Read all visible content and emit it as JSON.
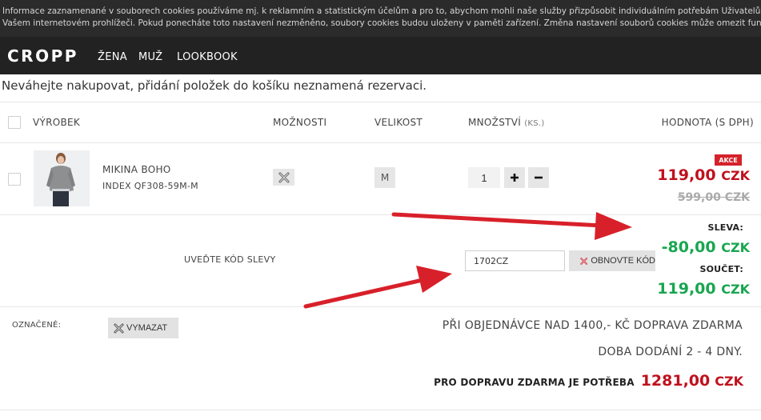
{
  "cookie_bar": {
    "line1": "Informace zaznamenané v souborech cookies používáme mj. k reklamním a statistickým účelům a pro to, abychom mohli naše služby přizpůsobit individuálním potřebám Uživatelů. Nastavení co",
    "line2": "Vašem internetovém prohlížeči. Pokud ponecháte toto nastavení nezměněno, soubory cookies budou uloženy v paměti zařízení. Změna nastavení souborů cookies může omezit funkčnost stránek"
  },
  "nav": {
    "logo": "CROPP",
    "links": [
      "ŽENA",
      "MUŽ",
      "LOOKBOOK"
    ]
  },
  "notice": "Neváhejte nakupovat, přidání položek do košíku neznamená rezervaci.",
  "table_headers": {
    "product": "VÝROBEK",
    "options": "MOŽNOSTI",
    "size": "VELIKOST",
    "quantity": "MNOŽSTVÍ",
    "quantity_unit": "(KS.)",
    "value": "HODNOTA (S DPH)"
  },
  "item": {
    "name": "MIKINA BOHO",
    "index": "INDEX QF308-59M-M",
    "size": "M",
    "quantity": "1",
    "badge": "AKCE",
    "price": "119,00",
    "currency": "CZK",
    "old_price": "599,00 CZK"
  },
  "discount": {
    "code_label": "UVEĎTE KÓD SLEVY",
    "code_value": "1702CZ",
    "renew_label": "OBNOVTE KÓD",
    "sleva_label": "SLEVA:",
    "sleva_value": "-80,00",
    "soucet_label": "SOUČET:",
    "soucet_value": "119,00",
    "currency": "CZK"
  },
  "footer": {
    "marked_label": "OZNAČENÉ:",
    "delete_label": "VYMAZAT",
    "shipping_info": "PŘI OBJEDNÁVCE NAD 1400,- KČ DOPRAVA ZDARMA",
    "delivery_time": "DOBA DODÁNÍ 2 - 4 DNY.",
    "free_shipping_label": "PRO DOPRAVU ZDARMA JE POTŘEBA",
    "free_shipping_value": "1281,00",
    "currency": "CZK"
  },
  "colors": {
    "price_red": "#c0111d",
    "discount_green": "#18a650",
    "arrow_red": "#d8202a",
    "nav_bg": "#222222"
  },
  "icons": {
    "remove_option": "x-icon",
    "increase": "plus-icon",
    "decrease": "minus-icon"
  }
}
